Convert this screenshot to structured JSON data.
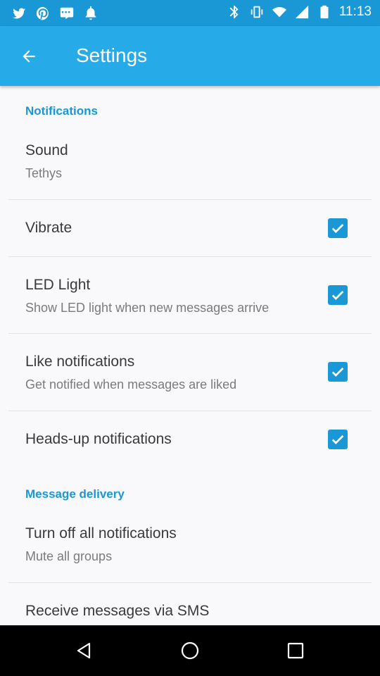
{
  "status_bar": {
    "left_icons": [
      "twitter-icon",
      "pinterest-icon",
      "chat-app-icon",
      "notification-app-icon"
    ],
    "right_icons": [
      "bluetooth-icon",
      "vibrate-icon",
      "wifi-icon",
      "signal-icon",
      "battery-icon"
    ],
    "time": "11:13"
  },
  "app_bar": {
    "title": "Settings",
    "back_icon": "arrow-back-icon"
  },
  "sections": {
    "notifications": {
      "header": "Notifications",
      "sound": {
        "title": "Sound",
        "subtitle": "Tethys"
      },
      "vibrate": {
        "title": "Vibrate",
        "checked": true
      },
      "led_light": {
        "title": "LED Light",
        "subtitle": "Show LED light when new messages arrive",
        "checked": true
      },
      "like_notifications": {
        "title": "Like notifications",
        "subtitle": "Get notified when messages are liked",
        "checked": true
      },
      "heads_up": {
        "title": "Heads-up notifications",
        "checked": true
      }
    },
    "message_delivery": {
      "header": "Message delivery",
      "turn_off": {
        "title": "Turn off all notifications",
        "subtitle": "Mute all groups"
      },
      "sms": {
        "title": "Receive messages via SMS"
      }
    }
  },
  "nav_bar": {
    "buttons": [
      "back-triangle-icon",
      "home-circle-icon",
      "recents-square-icon"
    ]
  },
  "colors": {
    "status_bar": "#1a98d5",
    "app_bar": "#27abe8",
    "accent": "#1a98d5",
    "background": "#f9f9fb"
  }
}
